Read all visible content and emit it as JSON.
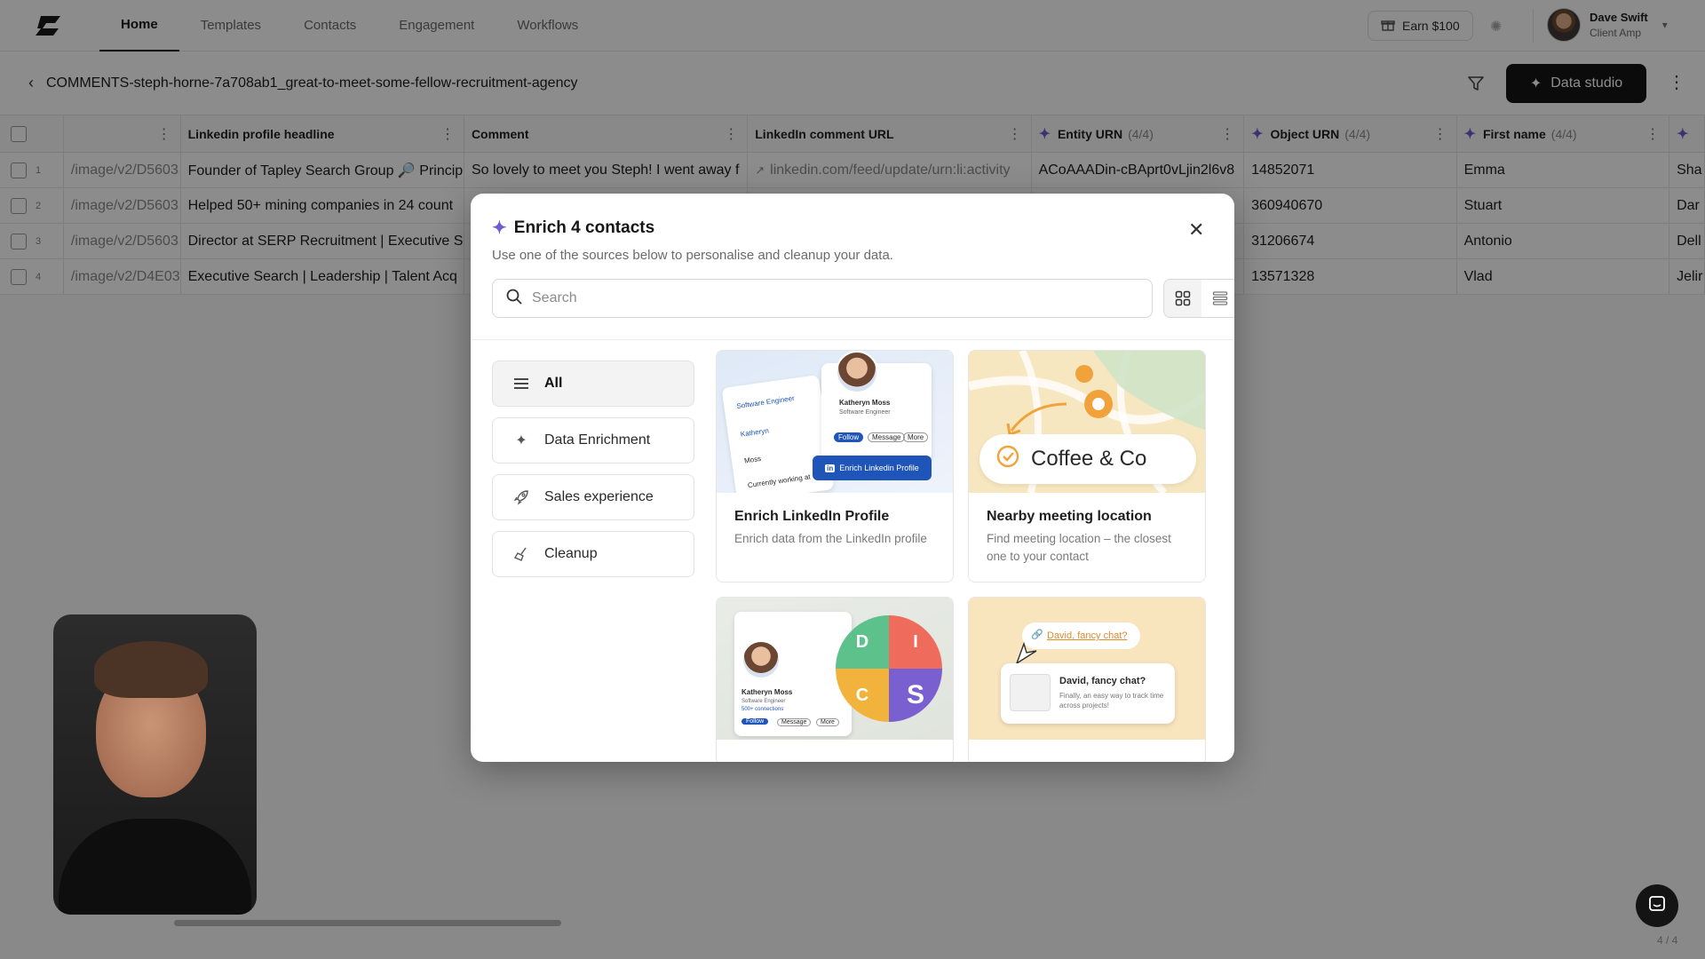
{
  "nav": {
    "tabs": [
      "Home",
      "Templates",
      "Contacts",
      "Engagement",
      "Workflows"
    ],
    "active_tab": "Home",
    "earn_label": "Earn $100",
    "user": {
      "name": "Dave Swift",
      "role": "Client Amp"
    }
  },
  "subheader": {
    "title": "COMMENTS-steph-horne-7a708ab1_great-to-meet-some-fellow-recruitment-agency",
    "studio_label": "Data studio"
  },
  "grid": {
    "columns": [
      {
        "label": ""
      },
      {
        "label": "Linkedin profile headline"
      },
      {
        "label": "Comment"
      },
      {
        "label": "LinkedIn comment URL"
      },
      {
        "label": "Entity URN",
        "count": "(4/4)"
      },
      {
        "label": "Object URN",
        "count": "(4/4)"
      },
      {
        "label": "First name",
        "count": "(4/4)"
      }
    ],
    "rows": [
      {
        "n": "1",
        "img": "/image/v2/D5603",
        "headline": "Founder of Tapley Search Group 🔎 Princip",
        "comment": "So lovely to meet you Steph! I went away f",
        "url": "linkedin.com/feed/update/urn:li:activity",
        "entity": "ACoAAADin-cBAprt0vLjin2l6v8",
        "object": "14852071",
        "first": "Emma",
        "next": "Sha"
      },
      {
        "n": "2",
        "img": "/image/v2/D5603",
        "headline": "Helped 50+ mining companies in 24 count",
        "comment": "",
        "url": "",
        "entity": "",
        "object": "360940670",
        "first": "Stuart",
        "next": "Dar"
      },
      {
        "n": "3",
        "img": "/image/v2/D5603",
        "headline": "Director at SERP Recruitment | Executive S",
        "comment": "",
        "url": "",
        "entity": "",
        "object": "31206674",
        "first": "Antonio",
        "next": "Dell"
      },
      {
        "n": "4",
        "img": "/image/v2/D4E03",
        "headline": "Executive Search | Leadership | Talent Acq",
        "comment": "",
        "url": "",
        "entity": "",
        "object": "13571328",
        "first": "Vlad",
        "next": "Jelir"
      }
    ]
  },
  "modal": {
    "title": "Enrich 4 contacts",
    "subtitle": "Use one of the sources below to personalise and cleanup your data.",
    "search_placeholder": "Search",
    "categories": [
      "All",
      "Data Enrichment",
      "Sales experience",
      "Cleanup"
    ],
    "active_category": "All",
    "cards": [
      {
        "title": "Enrich LinkedIn Profile",
        "desc": "Enrich data from the LinkedIn profile",
        "art": {
          "name": "Katheryn Moss",
          "role": "Software Engineer",
          "job_title": "Software Engineer",
          "first": "Katheryn",
          "last": "Moss",
          "working": "Currently working at",
          "button": "Enrich Linkedin Profile",
          "follow": "Follow",
          "message": "Message",
          "more": "More"
        }
      },
      {
        "title": "Nearby meeting location",
        "desc": "Find meeting location – the closest one to your contact",
        "art": {
          "label": "Coffee & Co"
        }
      },
      {
        "title": "",
        "desc": "",
        "art": {
          "name": "Katheryn Moss",
          "role": "Software Engineer",
          "connections": "500+ connections",
          "letters": [
            "D",
            "I",
            "C",
            "S"
          ],
          "follow": "Follow",
          "message": "Message",
          "more": "More"
        }
      },
      {
        "title": "",
        "desc": "",
        "art": {
          "bubble": "David, fancy chat?",
          "heading": "David, fancy chat?",
          "body": "Finally, an easy way to track time across projects!"
        }
      }
    ]
  },
  "footer": {
    "pager": "4 / 4"
  },
  "colors": {
    "accent": "#6d5bd0",
    "primary_button": "#141414",
    "linkedin_blue": "#1f55b8"
  },
  "icons": [
    "logo-icon",
    "gift-icon",
    "loading-icon",
    "chevron-down-icon",
    "back-arrow-icon",
    "filter-icon",
    "sparkle-icon",
    "kebab-icon",
    "close-icon",
    "search-icon",
    "grid-view-icon",
    "list-view-icon",
    "menu-icon",
    "rocket-icon",
    "broom-icon",
    "chat-icon",
    "external-link-icon"
  ]
}
